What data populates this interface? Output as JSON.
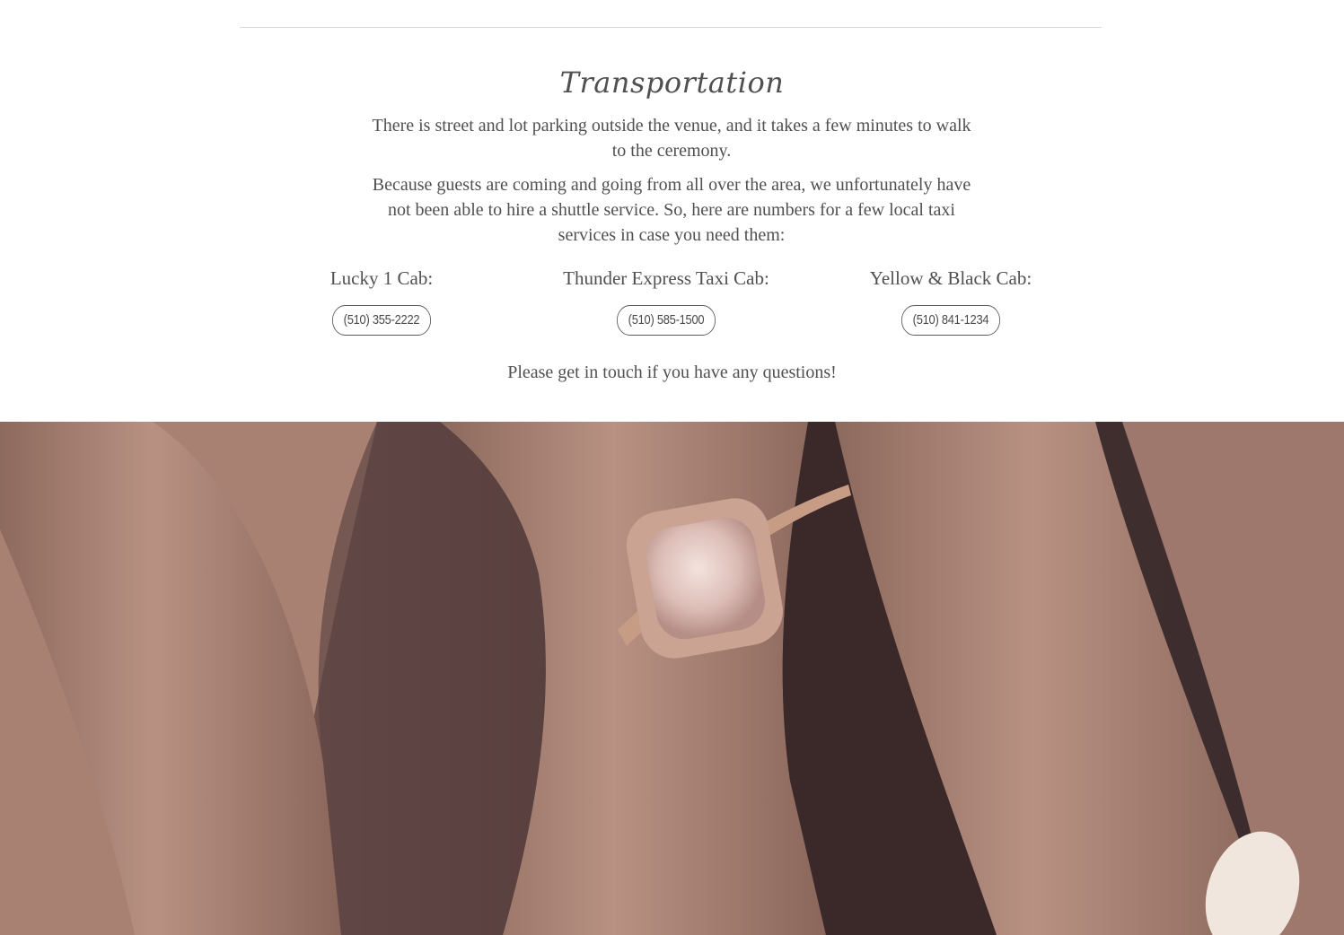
{
  "section": {
    "title": "Transportation",
    "paragraph_1": "There is street and lot parking outside the venue, and it takes a few minutes to walk to the ceremony.",
    "paragraph_2": "Because guests are coming and going from all over the area, we unfortunately have not been able to hire a shuttle service. So, here are numbers for a few local taxi services in case you need them:",
    "cabs": [
      {
        "name": "Lucky 1 Cab:",
        "phone": "(510) 355-2222"
      },
      {
        "name": "Thunder Express Taxi Cab:",
        "phone": "(510) 585-1500"
      },
      {
        "name": "Yellow & Black Cab:",
        "phone": "(510) 841-1234"
      }
    ],
    "closing": "Please get in touch if you have any questions!"
  },
  "photo": {
    "subject": "engagement-ring-on-hand",
    "colors": {
      "skin": "#b08878",
      "shadow": "#3e2c2c",
      "ring_gold": "#c49a82",
      "stone": "#e8d0cc"
    }
  }
}
